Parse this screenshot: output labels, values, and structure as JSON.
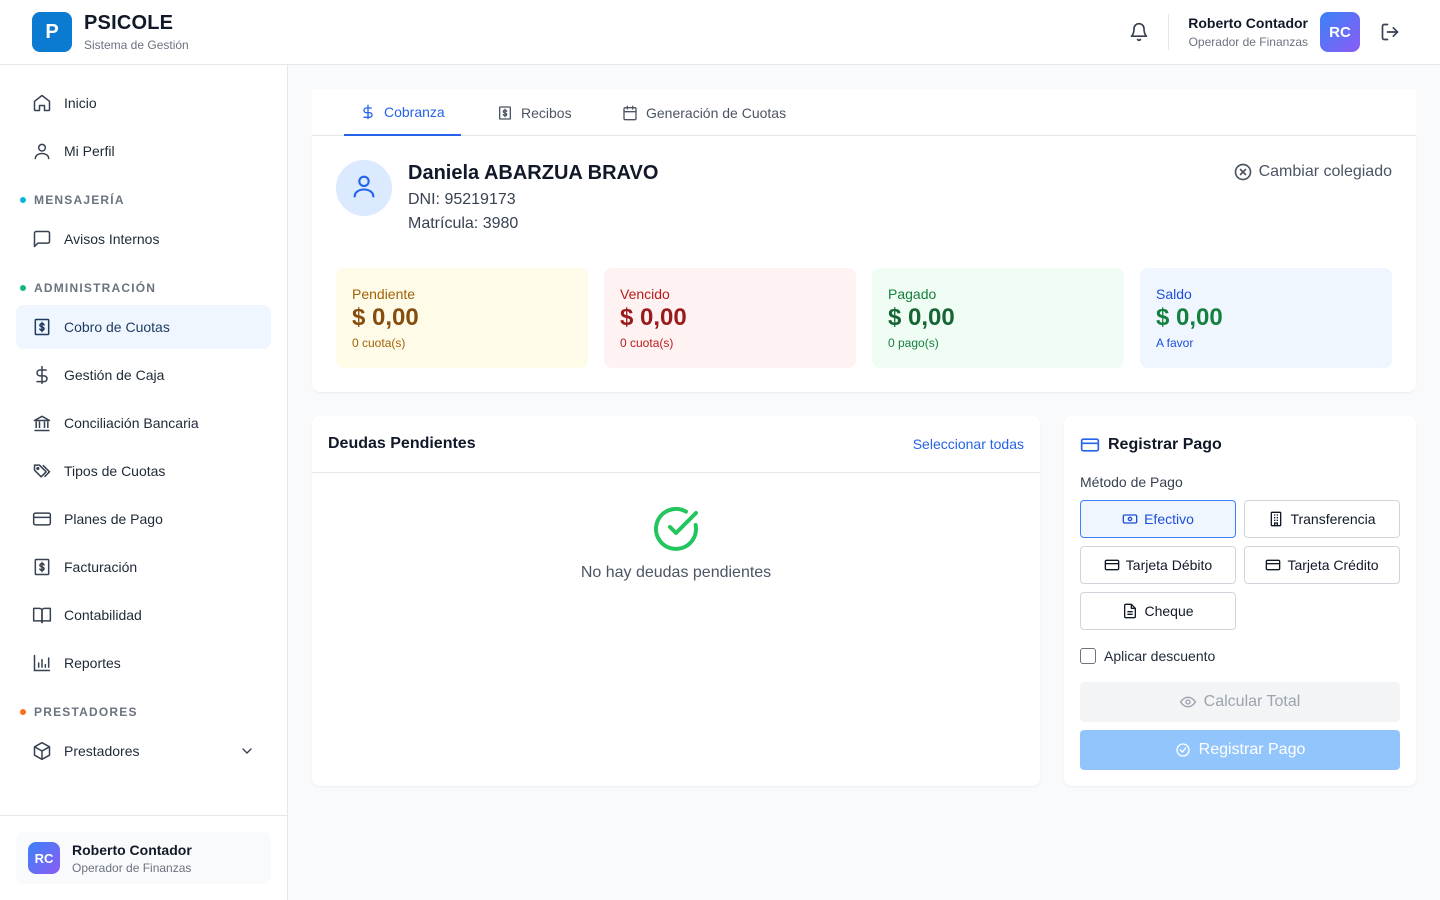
{
  "header": {
    "logo_letter": "P",
    "brand_name": "PSICOLE",
    "brand_subtitle": "Sistema de Gestión",
    "user_name": "Roberto Contador",
    "user_role": "Operador de Finanzas",
    "avatar_initials": "RC"
  },
  "sidebar": {
    "items": [
      {
        "label": "Inicio",
        "icon": "home-icon"
      },
      {
        "label": "Mi Perfil",
        "icon": "user-icon"
      }
    ],
    "sections": [
      {
        "label": "MENSAJERÍA",
        "dot_color": "#06b6d4",
        "items": [
          {
            "label": "Avisos Internos",
            "icon": "message-icon"
          }
        ]
      },
      {
        "label": "ADMINISTRACIÓN",
        "dot_color": "#10b981",
        "items": [
          {
            "label": "Cobro de Cuotas",
            "icon": "receipt-dollar-icon",
            "active": true
          },
          {
            "label": "Gestión de Caja",
            "icon": "dollar-icon"
          },
          {
            "label": "Conciliación Bancaria",
            "icon": "bank-icon"
          },
          {
            "label": "Tipos de Cuotas",
            "icon": "tags-icon"
          },
          {
            "label": "Planes de Pago",
            "icon": "credit-card-icon"
          },
          {
            "label": "Facturación",
            "icon": "invoice-icon"
          },
          {
            "label": "Contabilidad",
            "icon": "book-icon"
          },
          {
            "label": "Reportes",
            "icon": "bar-chart-icon"
          }
        ]
      },
      {
        "label": "PRESTADORES",
        "dot_color": "#f97316",
        "items": [
          {
            "label": "Prestadores",
            "icon": "package-icon",
            "expandable": true
          }
        ]
      }
    ],
    "footer": {
      "avatar_initials": "RC",
      "user_name": "Roberto Contador",
      "user_role": "Operador de Finanzas"
    }
  },
  "tabs": [
    {
      "label": "Cobranza",
      "icon": "dollar-icon",
      "active": true
    },
    {
      "label": "Recibos",
      "icon": "receipt-icon"
    },
    {
      "label": "Generación de Cuotas",
      "icon": "calendar-icon"
    }
  ],
  "profile": {
    "name": "Daniela ABARZUA BRAVO",
    "dni": "DNI: 95219173",
    "matricula": "Matrícula: 3980",
    "change_label": "Cambiar colegiado"
  },
  "stats": [
    {
      "label": "Pendiente",
      "value": "$ 0,00",
      "sub": "0 cuota(s)",
      "bg": "#fefce8",
      "label_color": "#a16207",
      "value_color": "#854d0e"
    },
    {
      "label": "Vencido",
      "value": "$ 0,00",
      "sub": "0 cuota(s)",
      "bg": "#fef2f2",
      "label_color": "#b91c1c",
      "value_color": "#991b1b"
    },
    {
      "label": "Pagado",
      "value": "$ 0,00",
      "sub": "0 pago(s)",
      "bg": "#f0fdf4",
      "label_color": "#15803d",
      "value_color": "#166534"
    },
    {
      "label": "Saldo",
      "value": "$ 0,00",
      "sub": "A favor",
      "bg": "#eff6ff",
      "label_color": "#1d4ed8",
      "value_color": "#15803d"
    }
  ],
  "debts": {
    "title": "Deudas Pendientes",
    "select_all": "Seleccionar todas",
    "empty_text": "No hay deudas pendientes"
  },
  "payment": {
    "title": "Registrar Pago",
    "method_label": "Método de Pago",
    "methods": [
      {
        "label": "Efectivo",
        "icon": "cash-icon",
        "selected": true
      },
      {
        "label": "Transferencia",
        "icon": "building-icon"
      },
      {
        "label": "Tarjeta Débito",
        "icon": "credit-card-icon"
      },
      {
        "label": "Tarjeta Crédito",
        "icon": "credit-card-icon"
      },
      {
        "label": "Cheque",
        "icon": "document-icon"
      }
    ],
    "discount_label": "Aplicar descuento",
    "calc_label": "Calcular Total",
    "register_label": "Registrar Pago"
  }
}
